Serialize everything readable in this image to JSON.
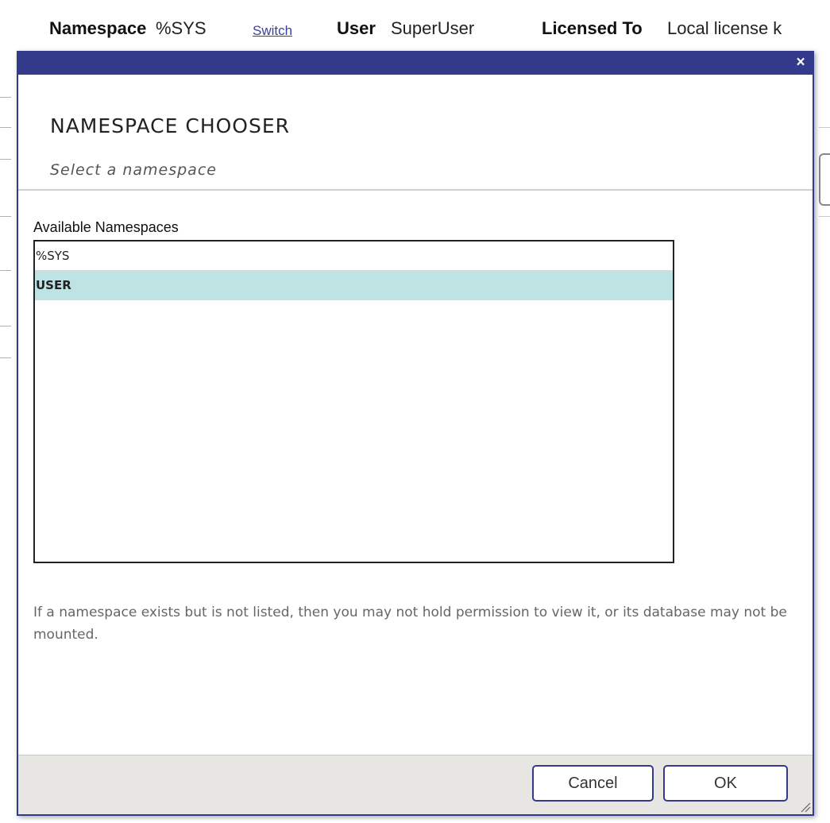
{
  "topbar": {
    "namespace_label": "Namespace",
    "namespace_value": "%SYS",
    "switch_link": "Switch",
    "user_label": "User",
    "user_value": "SuperUser",
    "licensed_label": "Licensed To",
    "licensed_value": "Local license k"
  },
  "dialog": {
    "title": "NAMESPACE CHOOSER",
    "subtitle": "Select a namespace",
    "close_glyph": "×",
    "list_label": "Available Namespaces",
    "namespaces": [
      {
        "name": "%SYS",
        "selected": false
      },
      {
        "name": "USER",
        "selected": true
      }
    ],
    "help_text": "If a namespace exists but is not listed, then you may not hold permission to view it, or its database may not be mounted.",
    "buttons": {
      "cancel": "Cancel",
      "ok": "OK"
    }
  },
  "colors": {
    "dialog_border": "#333a8c",
    "selected_row": "#bfe2e2",
    "footer_bg": "#e8e6e3"
  },
  "icons": {
    "close": "close-icon",
    "resize": "resize-grip-icon"
  }
}
